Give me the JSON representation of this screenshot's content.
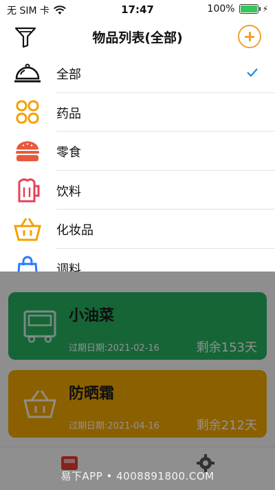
{
  "status_bar": {
    "carrier": "无 SIM 卡",
    "time": "17:47",
    "battery": "100%",
    "battery_level": 1.0
  },
  "navbar": {
    "title": "物品列表(全部)",
    "filter_icon": "filter-icon",
    "add_icon": "plus-circle-icon"
  },
  "categories": [
    {
      "label": "全部",
      "icon": "food-cloche-icon",
      "selected": true
    },
    {
      "label": "药品",
      "icon": "medicine-icon",
      "selected": false
    },
    {
      "label": "零食",
      "icon": "burger-icon",
      "selected": false
    },
    {
      "label": "饮料",
      "icon": "beer-mug-icon",
      "selected": false
    },
    {
      "label": "化妆品",
      "icon": "basket-icon",
      "selected": false
    },
    {
      "label": "调料",
      "icon": "shopping-bag-icon",
      "selected": false
    }
  ],
  "cards": [
    {
      "name": "小油菜",
      "expiry": "过期日期:2021-02-16",
      "remaining": "剩余153天",
      "color": "#27ae60",
      "icon": "bus-icon"
    },
    {
      "name": "防晒霜",
      "expiry": "过期日期:2021-04-16",
      "remaining": "剩余212天",
      "color": "#f0a500",
      "icon": "basket-icon"
    }
  ],
  "tabbar": {
    "items": [
      {
        "icon": "home-icon"
      },
      {
        "icon": "settings-icon"
      }
    ]
  },
  "watermark": "易下APP • 4008891800.COM",
  "colors": {
    "accent": "#f0a030",
    "check": "#1e88e5"
  }
}
